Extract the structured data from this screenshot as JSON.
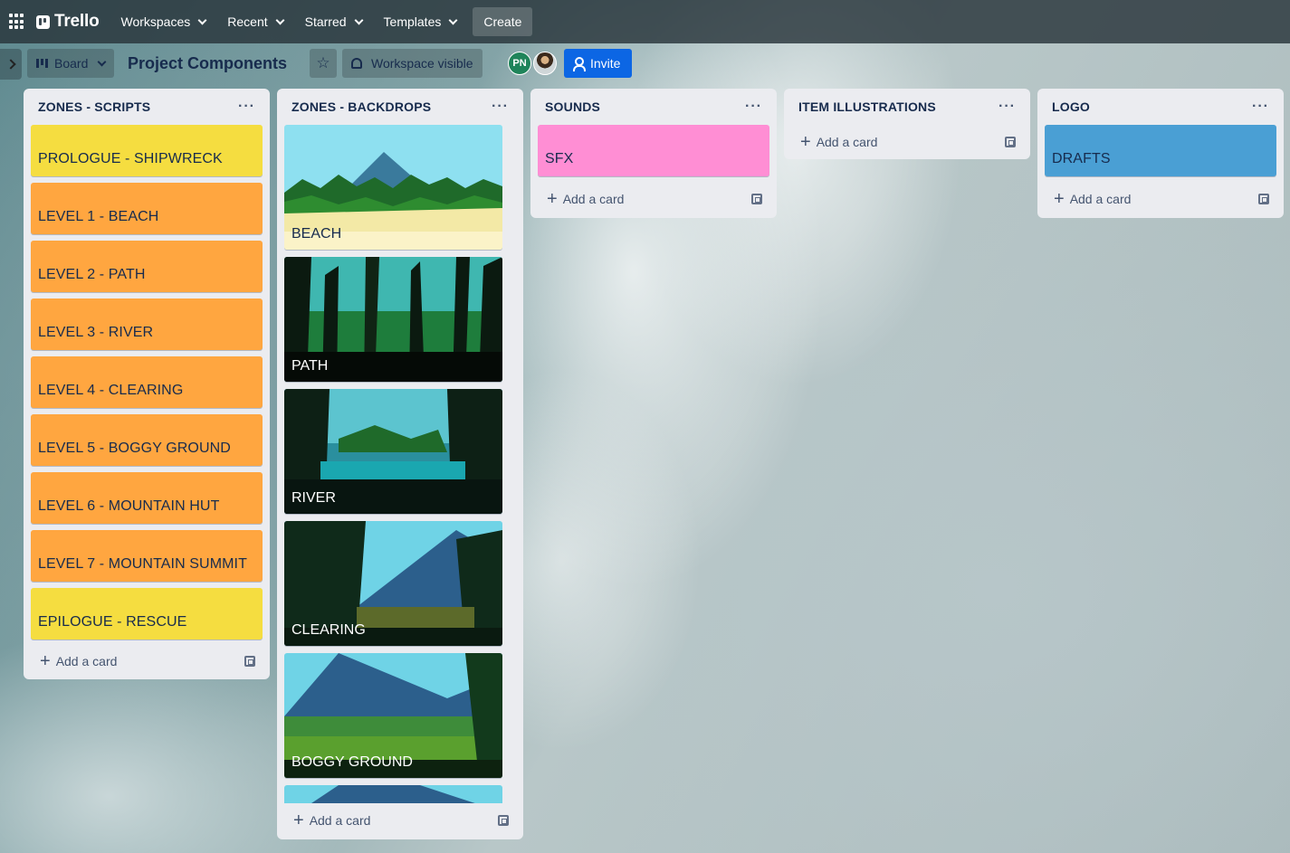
{
  "nav": {
    "apps_icon": "grid-icon",
    "logo_text": "Trello",
    "menus": [
      "Workspaces",
      "Recent",
      "Starred",
      "Templates"
    ],
    "create_label": "Create"
  },
  "board": {
    "view_label": "Board",
    "title": "Project Components",
    "visibility_label": "Workspace visible",
    "member_initials": "PN",
    "invite_label": "Invite"
  },
  "lists": [
    {
      "title": "ZONES - SCRIPTS",
      "cards": [
        {
          "label": "PROLOGUE - SHIPWRECK",
          "color": "#f5dd40"
        },
        {
          "label": "LEVEL 1 - BEACH",
          "color": "#ffa640"
        },
        {
          "label": "LEVEL 2 - PATH",
          "color": "#ffa640"
        },
        {
          "label": "LEVEL 3 - RIVER",
          "color": "#ffa640"
        },
        {
          "label": "LEVEL 4 - CLEARING",
          "color": "#ffa640"
        },
        {
          "label": "LEVEL 5 - BOGGY GROUND",
          "color": "#ffa640"
        },
        {
          "label": "LEVEL 6 - MOUNTAIN HUT",
          "color": "#ffa640"
        },
        {
          "label": "LEVEL 7 - MOUNTAIN SUMMIT",
          "color": "#ffa640"
        },
        {
          "label": "EPILOGUE - RESCUE",
          "color": "#f5dd40"
        }
      ],
      "add_label": "Add a card"
    },
    {
      "title": "ZONES - BACKDROPS",
      "cards": [
        {
          "label": "BEACH"
        },
        {
          "label": "PATH"
        },
        {
          "label": "RIVER"
        },
        {
          "label": "CLEARING"
        },
        {
          "label": "BOGGY GROUND"
        }
      ],
      "add_label": "Add a card"
    },
    {
      "title": "SOUNDS",
      "cards": [
        {
          "label": "SFX",
          "color": "#ff8ed4"
        }
      ],
      "add_label": "Add a card"
    },
    {
      "title": "ITEM ILLUSTRATIONS",
      "cards": [],
      "add_label": "Add a card"
    },
    {
      "title": "LOGO",
      "cards": [
        {
          "label": "DRAFTS",
          "color": "#4a9fd4"
        }
      ],
      "add_label": "Add a card"
    }
  ]
}
